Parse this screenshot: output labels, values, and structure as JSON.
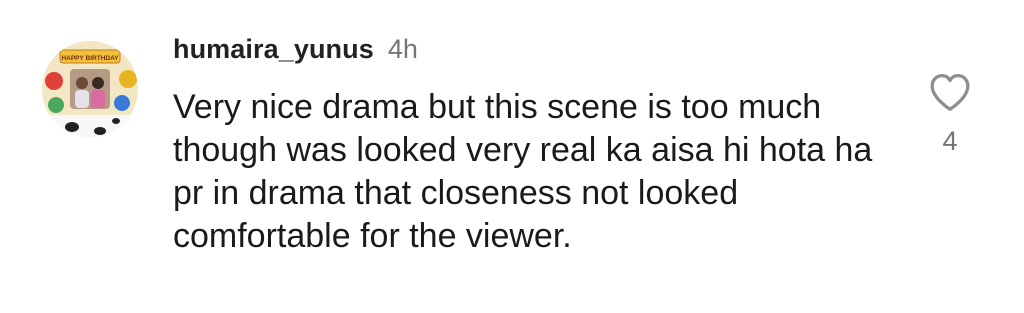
{
  "comment": {
    "username": "humaira_yunus",
    "timestamp": "4h",
    "text": "Very nice drama but this scene is too much though was looked very real ka aisa hi hota ha pr in drama that closeness not looked comfortable for the viewer.",
    "like_count": "4",
    "avatar_banner_text": "HAPPY BIRTHDAY"
  },
  "icons": {
    "like": "heart-outline-icon"
  },
  "colors": {
    "username": "#222222",
    "secondary_text": "#757575",
    "body_text": "#1a1a1a",
    "icon_stroke": "#8e8e8e"
  }
}
